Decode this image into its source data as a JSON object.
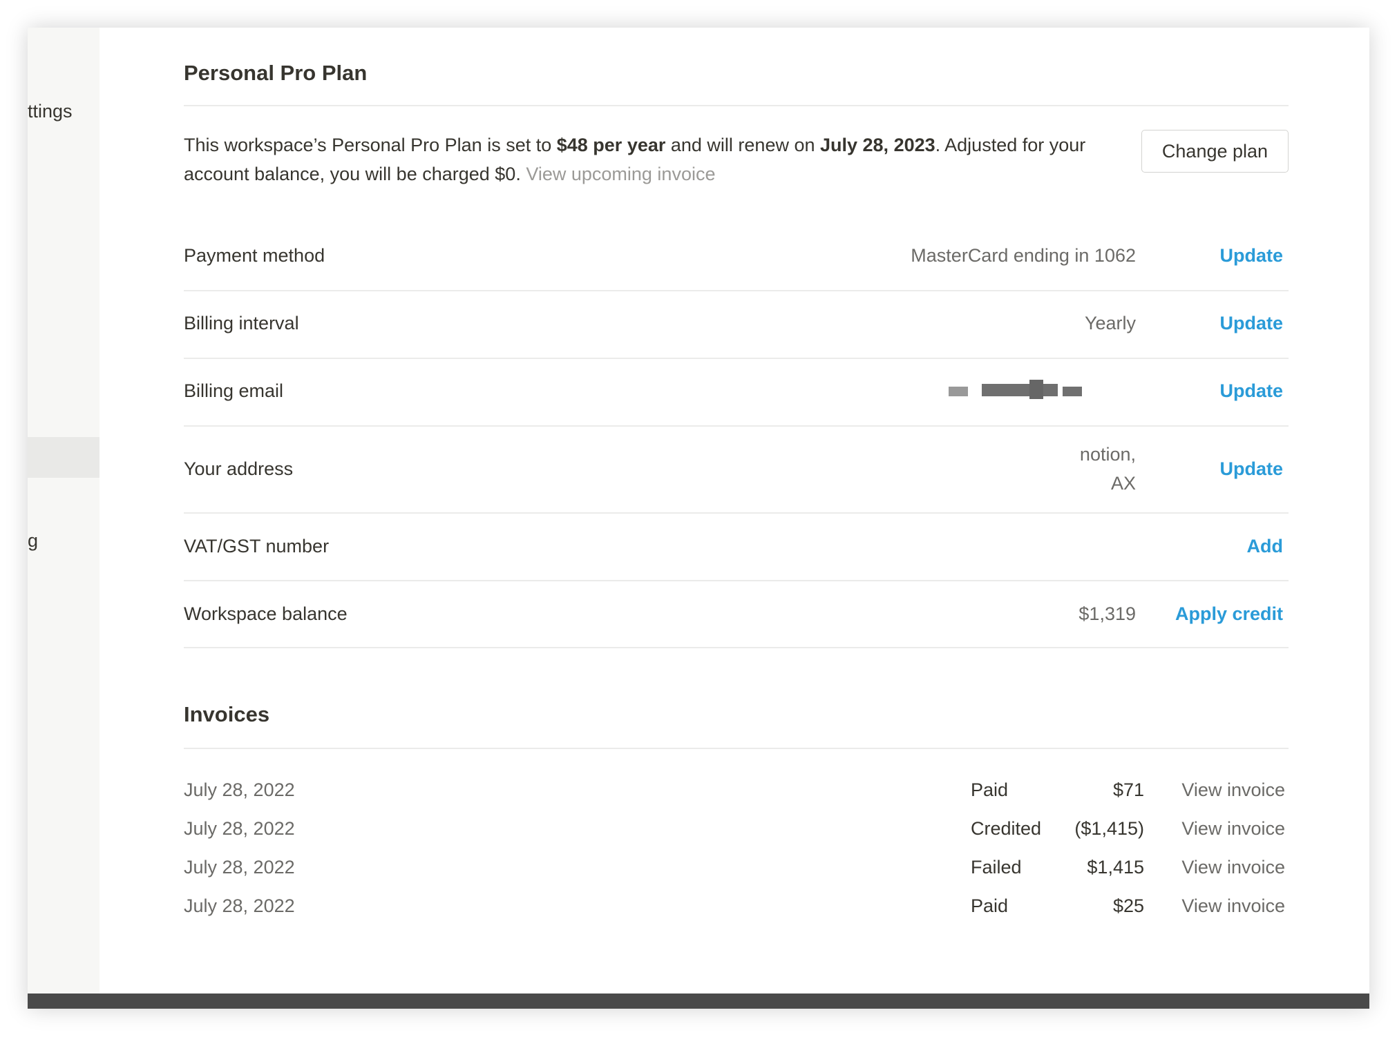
{
  "sidebar": {
    "item_top": "ttings",
    "item_bottom": "g"
  },
  "plan": {
    "title": "Personal Pro Plan",
    "text_1": "This workspace’s Personal Pro Plan is set to ",
    "price": "$48 per year",
    "text_2": " and will renew on ",
    "renew_date": "July 28, 2023",
    "text_3": ". Adjusted for your account balance, you will be charged $0. ",
    "upcoming_link": "View upcoming invoice",
    "change_plan": "Change plan"
  },
  "rows": [
    {
      "label": "Payment method",
      "value": "MasterCard ending in 1062",
      "action": "Update"
    },
    {
      "label": "Billing interval",
      "value": "Yearly",
      "action": "Update"
    },
    {
      "label": "Billing email",
      "value": "",
      "action": "Update"
    },
    {
      "label": "Your address",
      "value_line1": "notion,",
      "value_line2": "AX",
      "action": "Update"
    },
    {
      "label": "VAT/GST number",
      "value": "",
      "action": "Add"
    },
    {
      "label": "Workspace balance",
      "value": "$1,319",
      "action": "Apply credit"
    }
  ],
  "invoices": {
    "title": "Invoices",
    "items": [
      {
        "date": "July 28, 2022",
        "status": "Paid",
        "amount": "$71",
        "link": "View invoice"
      },
      {
        "date": "July 28, 2022",
        "status": "Credited",
        "amount": "($1,415)",
        "link": "View invoice"
      },
      {
        "date": "July 28, 2022",
        "status": "Failed",
        "amount": "$1,415",
        "link": "View invoice"
      },
      {
        "date": "July 28, 2022",
        "status": "Paid",
        "amount": "$25",
        "link": "View invoice"
      }
    ]
  },
  "colors": {
    "link": "#2a9bd8",
    "sidebar": "#f7f7f5"
  }
}
